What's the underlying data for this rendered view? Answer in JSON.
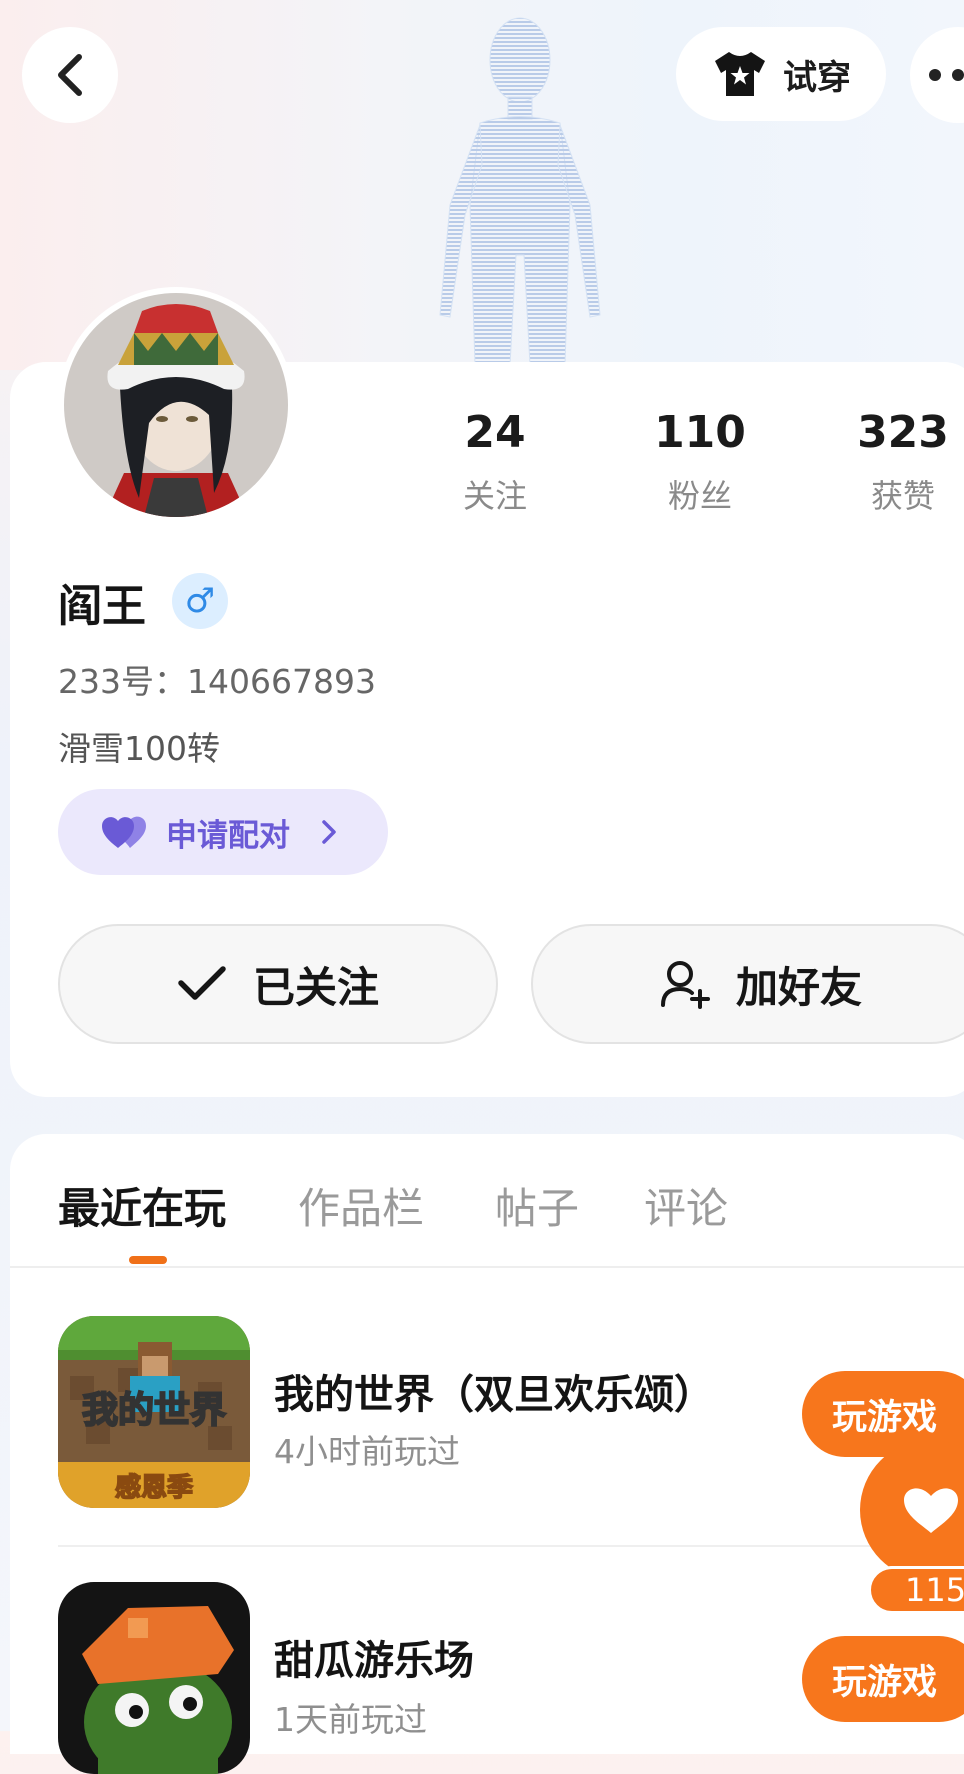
{
  "header": {
    "back_icon": "chevron-left-icon",
    "tryon_label": "试穿",
    "tryon_icon": "tshirt-star-icon",
    "more_icon": "more-dots-icon"
  },
  "profile": {
    "stats": [
      {
        "value": "24",
        "label": "关注"
      },
      {
        "value": "110",
        "label": "粉丝"
      },
      {
        "value": "323",
        "label": "获赞"
      }
    ],
    "username": "阎王",
    "gender_symbol": "♂",
    "uid": "233号：140667893",
    "bio": "滑雪100转",
    "pair_label": "申请配对",
    "follow_label": "已关注",
    "add_friend_label": "加好友"
  },
  "tabs": [
    {
      "label": "最近在玩",
      "active": true
    },
    {
      "label": "作品栏",
      "active": false
    },
    {
      "label": "帖子",
      "active": false
    },
    {
      "label": "评论",
      "active": false
    }
  ],
  "games": [
    {
      "title": "我的世界（双旦欢乐颂）",
      "time": "4小时前玩过",
      "play_label": "玩游戏",
      "icon_text": "我的世界",
      "icon_sub": "感恩季"
    },
    {
      "title": "甜瓜游乐场",
      "time": "1天前玩过",
      "play_label": "玩游戏"
    }
  ],
  "float_like": {
    "count": "115",
    "icon": "heart-icon"
  },
  "colors": {
    "accent": "#f7761c",
    "pair_bg": "#ebe8fc",
    "pair_text": "#6a5ad6"
  }
}
